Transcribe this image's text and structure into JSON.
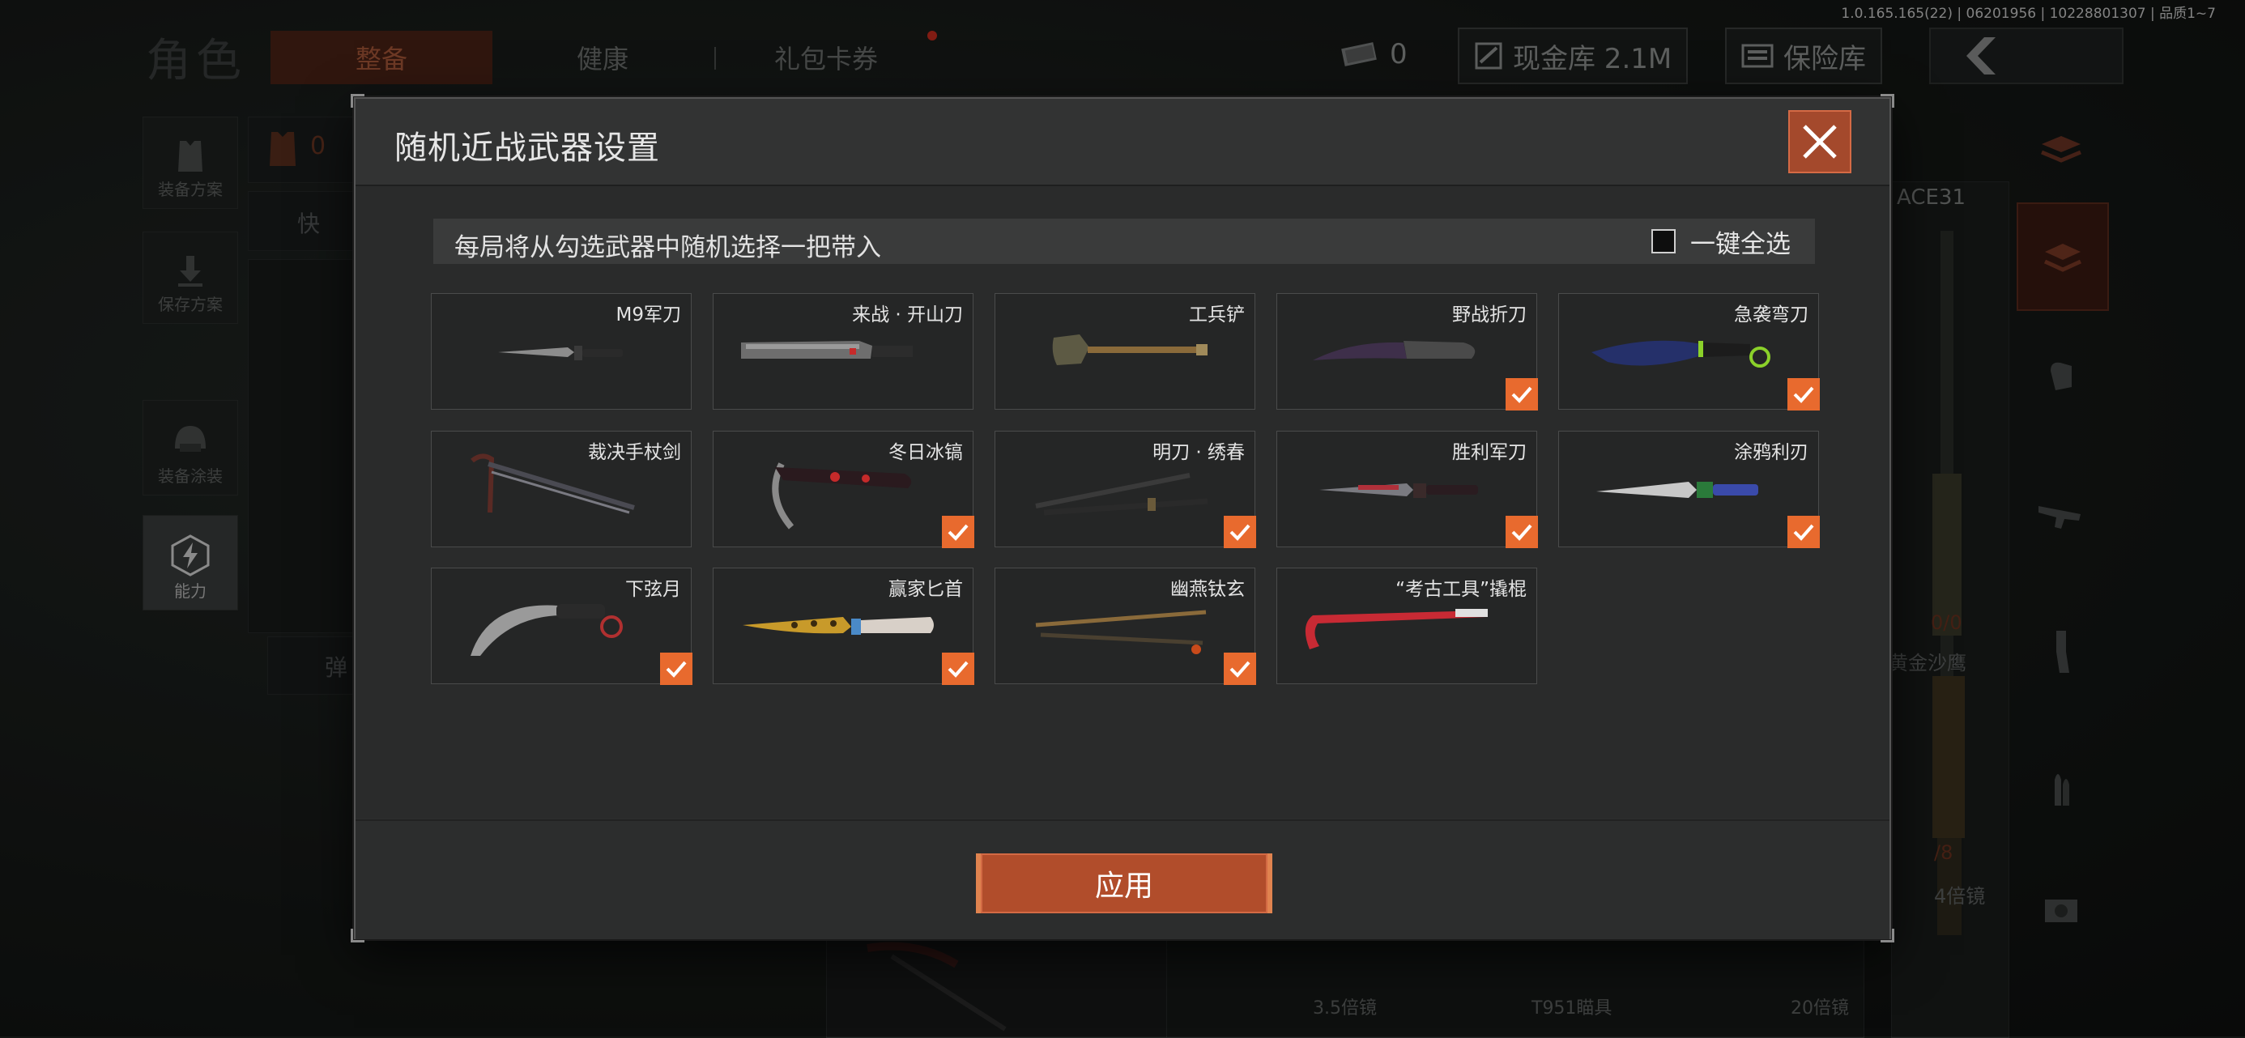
{
  "build_info": "1.0.165.165(22) | 06201956 | 10228801307 | 品质1~7",
  "background": {
    "page_title": "角色",
    "tabs": [
      {
        "label": "整备",
        "active": true
      },
      {
        "label": "健康",
        "active": false
      },
      {
        "label": "礼包卡券",
        "active": false
      }
    ],
    "currency": {
      "cash_count": "0",
      "vault_label": "现金库 2.1M",
      "safe_label": "保险库"
    },
    "left_menu": [
      {
        "label": "装备方案"
      },
      {
        "label": "保存方案"
      },
      {
        "label": "装备涂装"
      },
      {
        "label": "能力"
      }
    ],
    "armor_count": "0",
    "quick_label": "快",
    "ammo_label": "弹",
    "right_panel": {
      "weapon_name": "ACE31",
      "ammo_a": "0/0",
      "ammo_b": "/8",
      "pistol_name": "黄金沙鹰",
      "scope_a": "4倍镜",
      "scope_b": "3.5倍镜",
      "scope_c": "T951瞄具",
      "scope_d": "20倍镜"
    }
  },
  "modal": {
    "title": "随机近战武器设置",
    "description": "每局将从勾选武器中随机选择一把带入",
    "select_all_label": "一键全选",
    "select_all_checked": false,
    "apply_label": "应用",
    "accent_color": "#e86a2e",
    "weapons": [
      {
        "name": "M9军刀",
        "checked": false,
        "icon": "m9-bayonet-icon"
      },
      {
        "name": "来战 · 开山刀",
        "checked": false,
        "icon": "machete-icon"
      },
      {
        "name": "工兵铲",
        "checked": false,
        "icon": "shovel-icon"
      },
      {
        "name": "野战折刀",
        "checked": true,
        "icon": "field-knife-icon"
      },
      {
        "name": "急袭弯刀",
        "checked": true,
        "icon": "curved-blade-icon"
      },
      {
        "name": "裁决手杖剑",
        "checked": false,
        "icon": "cane-sword-icon"
      },
      {
        "name": "冬日冰镐",
        "checked": true,
        "icon": "ice-axe-icon"
      },
      {
        "name": "明刀 · 绣春",
        "checked": true,
        "icon": "xiuchun-blade-icon"
      },
      {
        "name": "胜利军刀",
        "checked": true,
        "icon": "victory-knife-icon"
      },
      {
        "name": "涂鸦利刃",
        "checked": true,
        "icon": "graffiti-knife-icon"
      },
      {
        "name": "下弦月",
        "checked": true,
        "icon": "karambit-icon"
      },
      {
        "name": "赢家匕首",
        "checked": true,
        "icon": "gold-dagger-icon"
      },
      {
        "name": "幽燕钛玄",
        "checked": true,
        "icon": "twin-blade-icon"
      },
      {
        "name": "“考古工具”撬棍",
        "checked": false,
        "icon": "crowbar-icon"
      }
    ]
  }
}
